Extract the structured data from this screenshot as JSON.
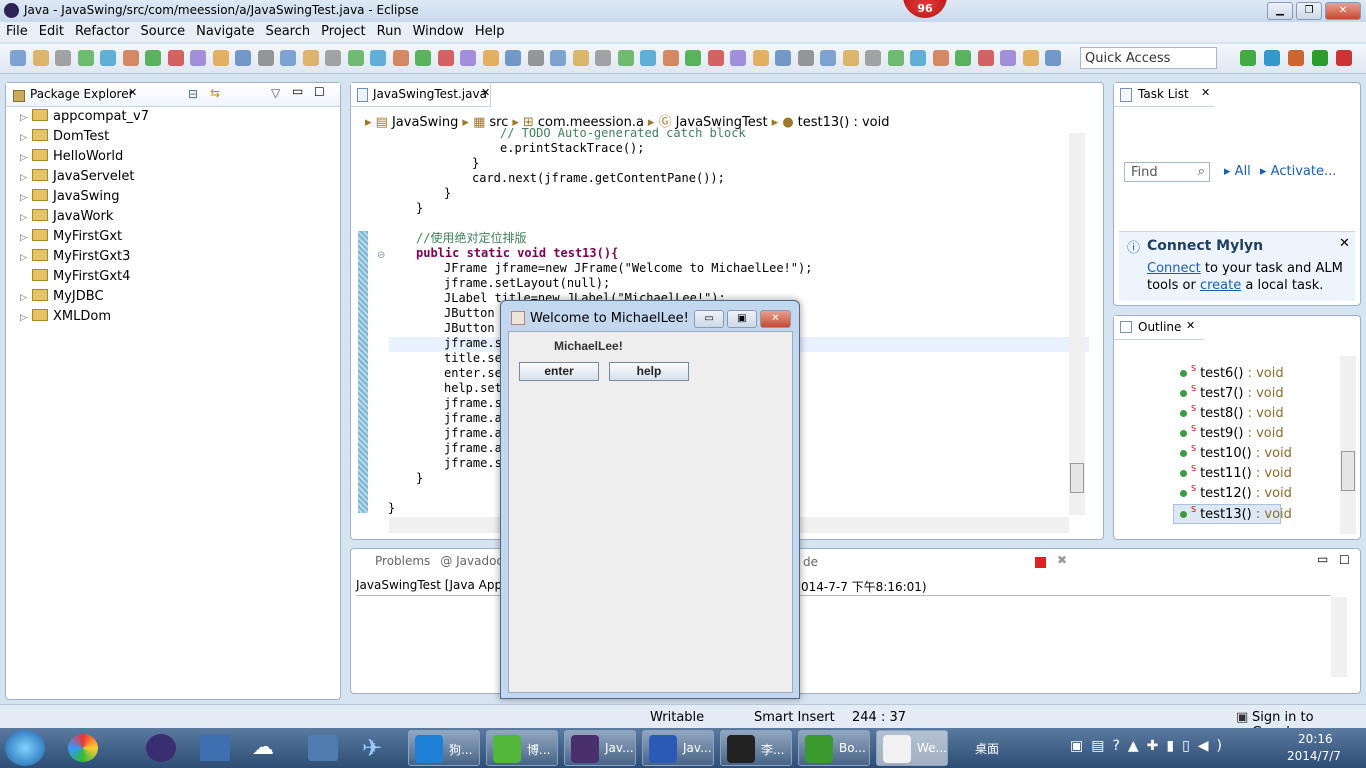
{
  "window": {
    "title": "Java - JavaSwing/src/com/meession/a/JavaSwingTest.java - Eclipse",
    "badge": "96"
  },
  "menu": [
    "File",
    "Edit",
    "Refactor",
    "Source",
    "Navigate",
    "Search",
    "Project",
    "Run",
    "Window",
    "Help"
  ],
  "quick_access": {
    "placeholder": "Quick Access"
  },
  "package_explorer": {
    "title": "Package Explorer",
    "projects": [
      "appcompat_v7",
      "DomTest",
      "HelloWorld",
      "JavaServelet",
      "JavaSwing",
      "JavaWork",
      "MyFirstGxt",
      "MyFirstGxt3",
      "MyFirstGxt4",
      "MyJDBC",
      "XMLDom"
    ]
  },
  "editor": {
    "tab": "JavaSwingTest.java",
    "breadcrumb": [
      "JavaSwing",
      "src",
      "com.meession.a",
      "JavaSwingTest",
      "test13() : void"
    ],
    "lines": [
      {
        "indent": 4,
        "text": "// TODO Auto-generated catch block",
        "style": "cm"
      },
      {
        "indent": 4,
        "text": "e.printStackTrace();"
      },
      {
        "indent": 3,
        "text": "}"
      },
      {
        "indent": 3,
        "text": "card.next(jframe.getContentPane());"
      },
      {
        "indent": 2,
        "text": "}"
      },
      {
        "indent": 1,
        "text": "}"
      },
      {
        "indent": 0,
        "text": ""
      },
      {
        "indent": 1,
        "text": "//使用绝对定位排版",
        "style": "cm"
      },
      {
        "indent": 1,
        "text": "public static void test13(){",
        "style": "kwline"
      },
      {
        "indent": 2,
        "text": "JFrame jframe=new JFrame(\"Welcome to MichaelLee!\");"
      },
      {
        "indent": 2,
        "text": "jframe.setLayout(null);"
      },
      {
        "indent": 2,
        "text": "JLabel title=new JLabel(\"MichaelLee!\");"
      },
      {
        "indent": 2,
        "text": "JButton"
      },
      {
        "indent": 2,
        "text": "JButton"
      },
      {
        "indent": 2,
        "text": "jframe.s"
      },
      {
        "indent": 2,
        "text": "title.se"
      },
      {
        "indent": 2,
        "text": "enter.se"
      },
      {
        "indent": 2,
        "text": "help.set"
      },
      {
        "indent": 2,
        "text": "jframe.s"
      },
      {
        "indent": 2,
        "text": "jframe.a"
      },
      {
        "indent": 2,
        "text": "jframe.a"
      },
      {
        "indent": 2,
        "text": "jframe.a"
      },
      {
        "indent": 2,
        "text": "jframe.s"
      },
      {
        "indent": 1,
        "text": "}"
      },
      {
        "indent": 0,
        "text": ""
      },
      {
        "indent": 0,
        "text": "}"
      }
    ]
  },
  "task_list": {
    "title": "Task List",
    "find_placeholder": "Find",
    "all": "All",
    "activate": "Activate...",
    "mylyn": {
      "title": "Connect Mylyn",
      "connect": "Connect",
      "text1": " to your task and ALM",
      "text2": "tools or ",
      "create": "create",
      "text3": " a local task."
    }
  },
  "outline": {
    "title": "Outline",
    "items": [
      "test6()",
      "test7()",
      "test8()",
      "test9()",
      "test10()",
      "test11()",
      "test12()",
      "test13()"
    ],
    "return_type": " : void",
    "selected": "test13()"
  },
  "console": {
    "tabs": [
      "Problems",
      "@ Javadoc"
    ],
    "tab_tail": "de",
    "line_left": "JavaSwingTest [Java App",
    "line_right": "014-7-7 下午8:16:01)"
  },
  "swing_window": {
    "title": "Welcome to MichaelLee!",
    "label": "MichaelLee!",
    "buttons": [
      "enter",
      "help"
    ]
  },
  "status": {
    "writable": "Writable",
    "insert": "Smart Insert",
    "position": "244 : 37",
    "sign_in": "Sign in to Google..."
  },
  "taskbar": {
    "tasks": [
      {
        "label": "狗...",
        "color": "#1d7fd6"
      },
      {
        "label": "博...",
        "color": "#53b83a"
      },
      {
        "label": "Jav...",
        "color": "#4a2f6d"
      },
      {
        "label": "Jav...",
        "color": "#2a5ab5"
      },
      {
        "label": "李...",
        "color": "#222222"
      },
      {
        "label": "Bo...",
        "color": "#3b9b2e"
      },
      {
        "label": "We...",
        "color": "#f1f1f1"
      }
    ],
    "desktop": "桌面",
    "time": "20:16",
    "date": "2014/7/7"
  }
}
